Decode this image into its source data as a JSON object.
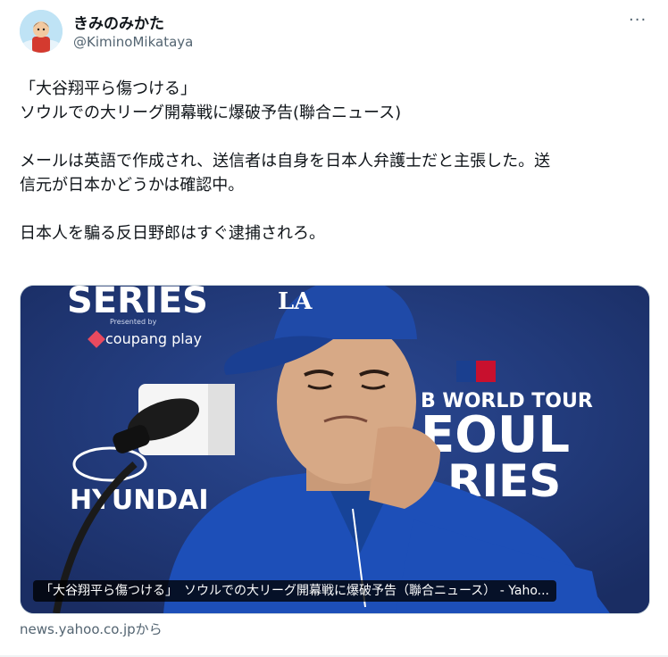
{
  "author": {
    "display_name": "きみのみかた",
    "handle": "@KiminoMikataya",
    "avatar_icon": "avatar-character-icon"
  },
  "more_icon": "more-dots-icon",
  "more_glyph": "···",
  "tweet": {
    "lines": [
      "「大谷翔平ら傷つける」",
      "ソウルでの大リーグ開幕戦に爆破予告(聯合ニュース)",
      "",
      "メールは英語で作成され、送信者は自身を日本人弁護士だと主張した。送",
      "信元が日本かどうかは確認中。",
      "",
      "日本人を騙る反日野郎はすぐ逮捕されろ。"
    ]
  },
  "card": {
    "caption": "「大谷翔平ら傷つける」　ソウルでの大リーグ開幕戦に爆破予告（聯合ニュース） - Yaho...",
    "image_text": {
      "series_top": "SERIES",
      "presented_by": "Presented by",
      "sponsor": "coupang play",
      "world_tour": "B WORLD TOUR",
      "seoul": "EOUL",
      "series_bottom": "RIES",
      "sponsor2": "HYUNDAI"
    },
    "colors": {
      "backdrop": "#233a7c",
      "jersey": "#1d4fb8",
      "cap": "#1f4aa8"
    }
  },
  "source": "news.yahoo.co.jpから"
}
